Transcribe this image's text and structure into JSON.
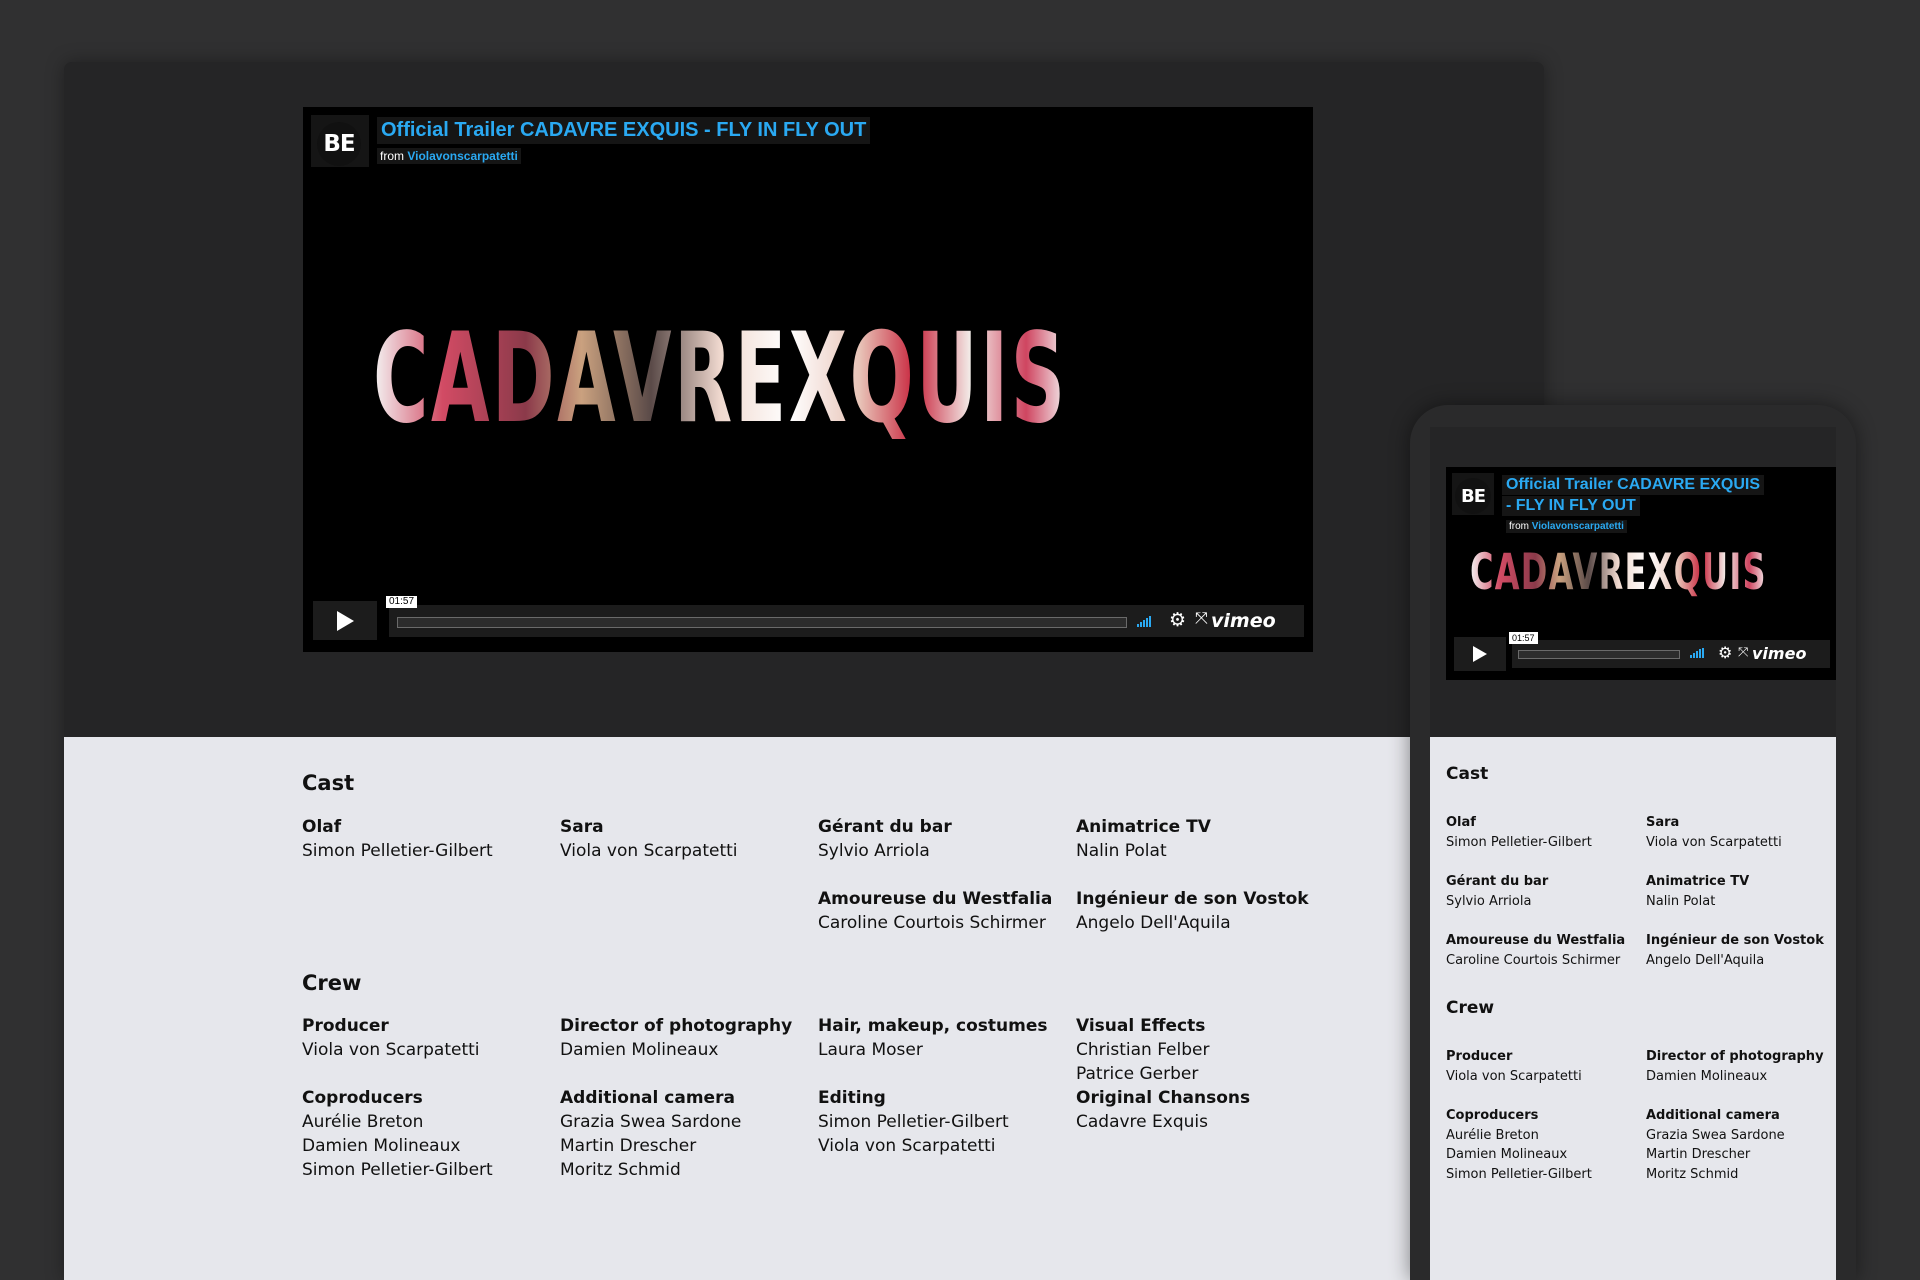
{
  "video": {
    "title": "Official Trailer CADAVRE EXQUIS - FLY IN FLY OUT",
    "title_line1": "Official Trailer CADAVRE EXQUIS",
    "title_line2": "- FLY IN FLY OUT",
    "from_label": "from",
    "author": "Violavonscarpatetti",
    "brand_logo": "BE",
    "film_title": "CADAVREXQUIS",
    "duration": "01:57",
    "provider": "vimeo",
    "icons": [
      "play-icon",
      "volume-icon",
      "gear-icon",
      "fullscreen-icon",
      "vimeo-logo"
    ]
  },
  "colors": {
    "accent": "#2aa9f2",
    "page_dark": "#252526",
    "content_bg": "#e6e7ec"
  },
  "cast": {
    "heading": "Cast",
    "entries": [
      {
        "role": "Olaf",
        "names": [
          "Simon Pelletier-Gilbert"
        ]
      },
      {
        "role": "Sara",
        "names": [
          "Viola von Scarpatetti"
        ]
      },
      {
        "role": "Gérant du bar",
        "names": [
          "Sylvio Arriola"
        ]
      },
      {
        "role": "Animatrice TV",
        "names": [
          "Nalin Polat"
        ]
      },
      {
        "role": "Amoureuse du Westfalia",
        "names": [
          "Caroline Courtois Schirmer"
        ]
      },
      {
        "role": "Ingénieur de son Vostok",
        "names": [
          "Angelo Dell'Aquila"
        ]
      }
    ]
  },
  "crew": {
    "heading": "Crew",
    "entries": [
      {
        "role": "Producer",
        "names": [
          "Viola von Scarpatetti"
        ]
      },
      {
        "role": "Director of photography",
        "names": [
          "Damien Molineaux"
        ]
      },
      {
        "role": "Hair, makeup, costumes",
        "names": [
          "Laura Moser"
        ]
      },
      {
        "role": "Visual Effects",
        "names": [
          "Christian Felber",
          "Patrice Gerber"
        ]
      },
      {
        "role": "Coproducers",
        "names": [
          "Aurélie Breton",
          "Damien Molineaux",
          "Simon Pelletier-Gilbert"
        ]
      },
      {
        "role": "Additional camera",
        "names": [
          "Grazia Swea Sardone",
          "Martin Drescher",
          "Moritz Schmid"
        ]
      },
      {
        "role": "Editing",
        "names": [
          "Simon Pelletier-Gilbert",
          "Viola von Scarpatetti"
        ]
      },
      {
        "role": "Original Chansons",
        "names": [
          "Cadavre Exquis"
        ]
      }
    ]
  }
}
